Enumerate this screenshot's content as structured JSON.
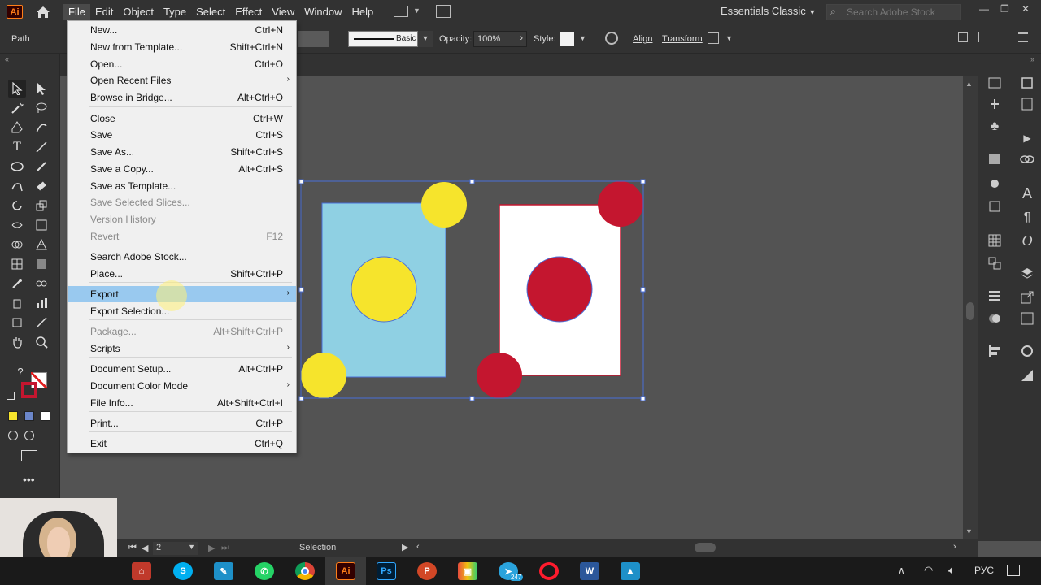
{
  "app": {
    "logo": "Ai",
    "workspace": "Essentials Classic",
    "search_placeholder": "Search Adobe Stock"
  },
  "menubar": [
    "File",
    "Edit",
    "Object",
    "Type",
    "Select",
    "Effect",
    "View",
    "Window",
    "Help"
  ],
  "control_bar": {
    "selection_label": "Path",
    "stroke_style": "Basic",
    "opacity_label": "Opacity:",
    "opacity_value": "100%",
    "style_label": "Style:",
    "align_label": "Align",
    "transform_label": "Transform"
  },
  "file_menu": [
    {
      "label": "New...",
      "shortcut": "Ctrl+N"
    },
    {
      "label": "New from Template...",
      "shortcut": "Shift+Ctrl+N"
    },
    {
      "label": "Open...",
      "shortcut": "Ctrl+O"
    },
    {
      "label": "Open Recent Files",
      "submenu": true
    },
    {
      "label": "Browse in Bridge...",
      "shortcut": "Alt+Ctrl+O"
    },
    {
      "label": "Close",
      "shortcut": "Ctrl+W"
    },
    {
      "label": "Save",
      "shortcut": "Ctrl+S"
    },
    {
      "label": "Save As...",
      "shortcut": "Shift+Ctrl+S"
    },
    {
      "label": "Save a Copy...",
      "shortcut": "Alt+Ctrl+S"
    },
    {
      "label": "Save as Template..."
    },
    {
      "label": "Save Selected Slices...",
      "disabled": true
    },
    {
      "label": "Version History",
      "disabled": true
    },
    {
      "label": "Revert",
      "shortcut": "F12",
      "disabled": true
    },
    {
      "label": "Search Adobe Stock..."
    },
    {
      "label": "Place...",
      "shortcut": "Shift+Ctrl+P"
    },
    {
      "label": "Export",
      "submenu": true,
      "highlighted": true
    },
    {
      "label": "Export Selection..."
    },
    {
      "label": "Package...",
      "shortcut": "Alt+Shift+Ctrl+P",
      "disabled": true
    },
    {
      "label": "Scripts",
      "submenu": true
    },
    {
      "label": "Document Setup...",
      "shortcut": "Alt+Ctrl+P"
    },
    {
      "label": "Document Color Mode",
      "submenu": true
    },
    {
      "label": "File Info...",
      "shortcut": "Alt+Shift+Ctrl+I"
    },
    {
      "label": "Print...",
      "shortcut": "Ctrl+P"
    },
    {
      "label": "Exit",
      "shortcut": "Ctrl+Q"
    }
  ],
  "status": {
    "artboard_number": "2",
    "tool_name": "Selection"
  },
  "taskbar": {
    "language": "РУС",
    "telegram_badge": "247"
  },
  "colors": {
    "accent_orange": "#ff7f18",
    "artboard_blue": "#8fd0e3",
    "dot_yellow": "#f6e42c",
    "dot_red": "#c4162f",
    "menu_highlight": "#99c9ef",
    "selection_blue": "#4a6fd8"
  }
}
